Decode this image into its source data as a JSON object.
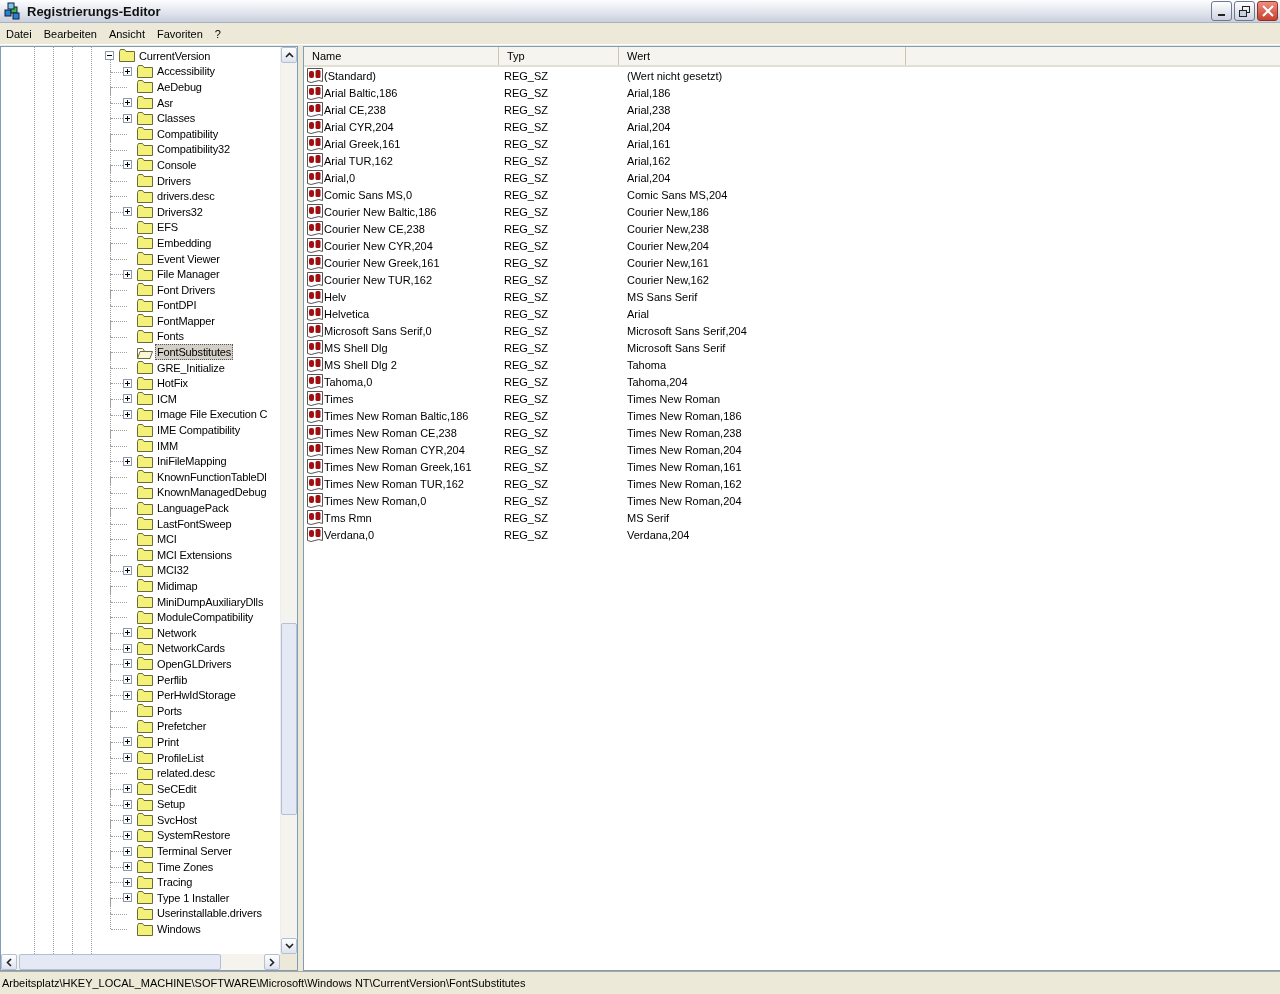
{
  "window": {
    "title": "Registrierungs-Editor"
  },
  "menu": [
    "Datei",
    "Bearbeiten",
    "Ansicht",
    "Favoriten",
    "?"
  ],
  "tree": {
    "label": "CurrentVersion",
    "expanded": true,
    "selected": false,
    "children": [
      {
        "label": "Accessibility",
        "expandable": true,
        "selected": false
      },
      {
        "label": "AeDebug",
        "expandable": false,
        "selected": false
      },
      {
        "label": "Asr",
        "expandable": true,
        "selected": false
      },
      {
        "label": "Classes",
        "expandable": true,
        "selected": false
      },
      {
        "label": "Compatibility",
        "expandable": false,
        "selected": false
      },
      {
        "label": "Compatibility32",
        "expandable": false,
        "selected": false
      },
      {
        "label": "Console",
        "expandable": true,
        "selected": false
      },
      {
        "label": "Drivers",
        "expandable": false,
        "selected": false
      },
      {
        "label": "drivers.desc",
        "expandable": false,
        "selected": false
      },
      {
        "label": "Drivers32",
        "expandable": true,
        "selected": false
      },
      {
        "label": "EFS",
        "expandable": false,
        "selected": false
      },
      {
        "label": "Embedding",
        "expandable": false,
        "selected": false
      },
      {
        "label": "Event Viewer",
        "expandable": false,
        "selected": false
      },
      {
        "label": "File Manager",
        "expandable": true,
        "selected": false
      },
      {
        "label": "Font Drivers",
        "expandable": false,
        "selected": false
      },
      {
        "label": "FontDPI",
        "expandable": false,
        "selected": false
      },
      {
        "label": "FontMapper",
        "expandable": false,
        "selected": false
      },
      {
        "label": "Fonts",
        "expandable": false,
        "selected": false
      },
      {
        "label": "FontSubstitutes",
        "expandable": false,
        "selected": true
      },
      {
        "label": "GRE_Initialize",
        "expandable": false,
        "selected": false
      },
      {
        "label": "HotFix",
        "expandable": true,
        "selected": false
      },
      {
        "label": "ICM",
        "expandable": true,
        "selected": false
      },
      {
        "label": "Image File Execution C",
        "expandable": true,
        "selected": false
      },
      {
        "label": "IME Compatibility",
        "expandable": false,
        "selected": false
      },
      {
        "label": "IMM",
        "expandable": false,
        "selected": false
      },
      {
        "label": "IniFileMapping",
        "expandable": true,
        "selected": false
      },
      {
        "label": "KnownFunctionTableDl",
        "expandable": false,
        "selected": false
      },
      {
        "label": "KnownManagedDebug",
        "expandable": false,
        "selected": false
      },
      {
        "label": "LanguagePack",
        "expandable": false,
        "selected": false
      },
      {
        "label": "LastFontSweep",
        "expandable": false,
        "selected": false
      },
      {
        "label": "MCI",
        "expandable": false,
        "selected": false
      },
      {
        "label": "MCI Extensions",
        "expandable": false,
        "selected": false
      },
      {
        "label": "MCI32",
        "expandable": true,
        "selected": false
      },
      {
        "label": "Midimap",
        "expandable": false,
        "selected": false
      },
      {
        "label": "MiniDumpAuxiliaryDlls",
        "expandable": false,
        "selected": false
      },
      {
        "label": "ModuleCompatibility",
        "expandable": false,
        "selected": false
      },
      {
        "label": "Network",
        "expandable": true,
        "selected": false
      },
      {
        "label": "NetworkCards",
        "expandable": true,
        "selected": false
      },
      {
        "label": "OpenGLDrivers",
        "expandable": true,
        "selected": false
      },
      {
        "label": "Perflib",
        "expandable": true,
        "selected": false
      },
      {
        "label": "PerHwIdStorage",
        "expandable": true,
        "selected": false
      },
      {
        "label": "Ports",
        "expandable": false,
        "selected": false
      },
      {
        "label": "Prefetcher",
        "expandable": false,
        "selected": false
      },
      {
        "label": "Print",
        "expandable": true,
        "selected": false
      },
      {
        "label": "ProfileList",
        "expandable": true,
        "selected": false
      },
      {
        "label": "related.desc",
        "expandable": false,
        "selected": false
      },
      {
        "label": "SeCEdit",
        "expandable": true,
        "selected": false
      },
      {
        "label": "Setup",
        "expandable": true,
        "selected": false
      },
      {
        "label": "SvcHost",
        "expandable": true,
        "selected": false
      },
      {
        "label": "SystemRestore",
        "expandable": true,
        "selected": false
      },
      {
        "label": "Terminal Server",
        "expandable": true,
        "selected": false
      },
      {
        "label": "Time Zones",
        "expandable": true,
        "selected": false
      },
      {
        "label": "Tracing",
        "expandable": true,
        "selected": false
      },
      {
        "label": "Type 1 Installer",
        "expandable": true,
        "selected": false
      },
      {
        "label": "Userinstallable.drivers",
        "expandable": false,
        "selected": false
      },
      {
        "label": "Windows",
        "expandable": false,
        "selected": false
      }
    ]
  },
  "table": {
    "columns": [
      "Name",
      "Typ",
      "Wert"
    ],
    "rows": [
      {
        "name": "(Standard)",
        "type": "REG_SZ",
        "value": "(Wert nicht gesetzt)"
      },
      {
        "name": "Arial Baltic,186",
        "type": "REG_SZ",
        "value": "Arial,186"
      },
      {
        "name": "Arial CE,238",
        "type": "REG_SZ",
        "value": "Arial,238"
      },
      {
        "name": "Arial CYR,204",
        "type": "REG_SZ",
        "value": "Arial,204"
      },
      {
        "name": "Arial Greek,161",
        "type": "REG_SZ",
        "value": "Arial,161"
      },
      {
        "name": "Arial TUR,162",
        "type": "REG_SZ",
        "value": "Arial,162"
      },
      {
        "name": "Arial,0",
        "type": "REG_SZ",
        "value": "Arial,204"
      },
      {
        "name": "Comic Sans MS,0",
        "type": "REG_SZ",
        "value": "Comic Sans MS,204"
      },
      {
        "name": "Courier New Baltic,186",
        "type": "REG_SZ",
        "value": "Courier New,186"
      },
      {
        "name": "Courier New CE,238",
        "type": "REG_SZ",
        "value": "Courier New,238"
      },
      {
        "name": "Courier New CYR,204",
        "type": "REG_SZ",
        "value": "Courier New,204"
      },
      {
        "name": "Courier New Greek,161",
        "type": "REG_SZ",
        "value": "Courier New,161"
      },
      {
        "name": "Courier New TUR,162",
        "type": "REG_SZ",
        "value": "Courier New,162"
      },
      {
        "name": "Helv",
        "type": "REG_SZ",
        "value": "MS Sans Serif"
      },
      {
        "name": "Helvetica",
        "type": "REG_SZ",
        "value": "Arial"
      },
      {
        "name": "Microsoft Sans Serif,0",
        "type": "REG_SZ",
        "value": "Microsoft Sans Serif,204"
      },
      {
        "name": "MS Shell Dlg",
        "type": "REG_SZ",
        "value": "Microsoft Sans Serif"
      },
      {
        "name": "MS Shell Dlg 2",
        "type": "REG_SZ",
        "value": "Tahoma"
      },
      {
        "name": "Tahoma,0",
        "type": "REG_SZ",
        "value": "Tahoma,204"
      },
      {
        "name": "Times",
        "type": "REG_SZ",
        "value": "Times New Roman"
      },
      {
        "name": "Times New Roman Baltic,186",
        "type": "REG_SZ",
        "value": "Times New Roman,186"
      },
      {
        "name": "Times New Roman CE,238",
        "type": "REG_SZ",
        "value": "Times New Roman,238"
      },
      {
        "name": "Times New Roman CYR,204",
        "type": "REG_SZ",
        "value": "Times New Roman,204"
      },
      {
        "name": "Times New Roman Greek,161",
        "type": "REG_SZ",
        "value": "Times New Roman,161"
      },
      {
        "name": "Times New Roman TUR,162",
        "type": "REG_SZ",
        "value": "Times New Roman,162"
      },
      {
        "name": "Times New Roman,0",
        "type": "REG_SZ",
        "value": "Times New Roman,204"
      },
      {
        "name": "Tms Rmn",
        "type": "REG_SZ",
        "value": "MS Serif"
      },
      {
        "name": "Verdana,0",
        "type": "REG_SZ",
        "value": "Verdana,204"
      }
    ]
  },
  "status_bar": "Arbeitsplatz\\HKEY_LOCAL_MACHINE\\SOFTWARE\\Microsoft\\Windows NT\\CurrentVersion\\FontSubstitutes"
}
